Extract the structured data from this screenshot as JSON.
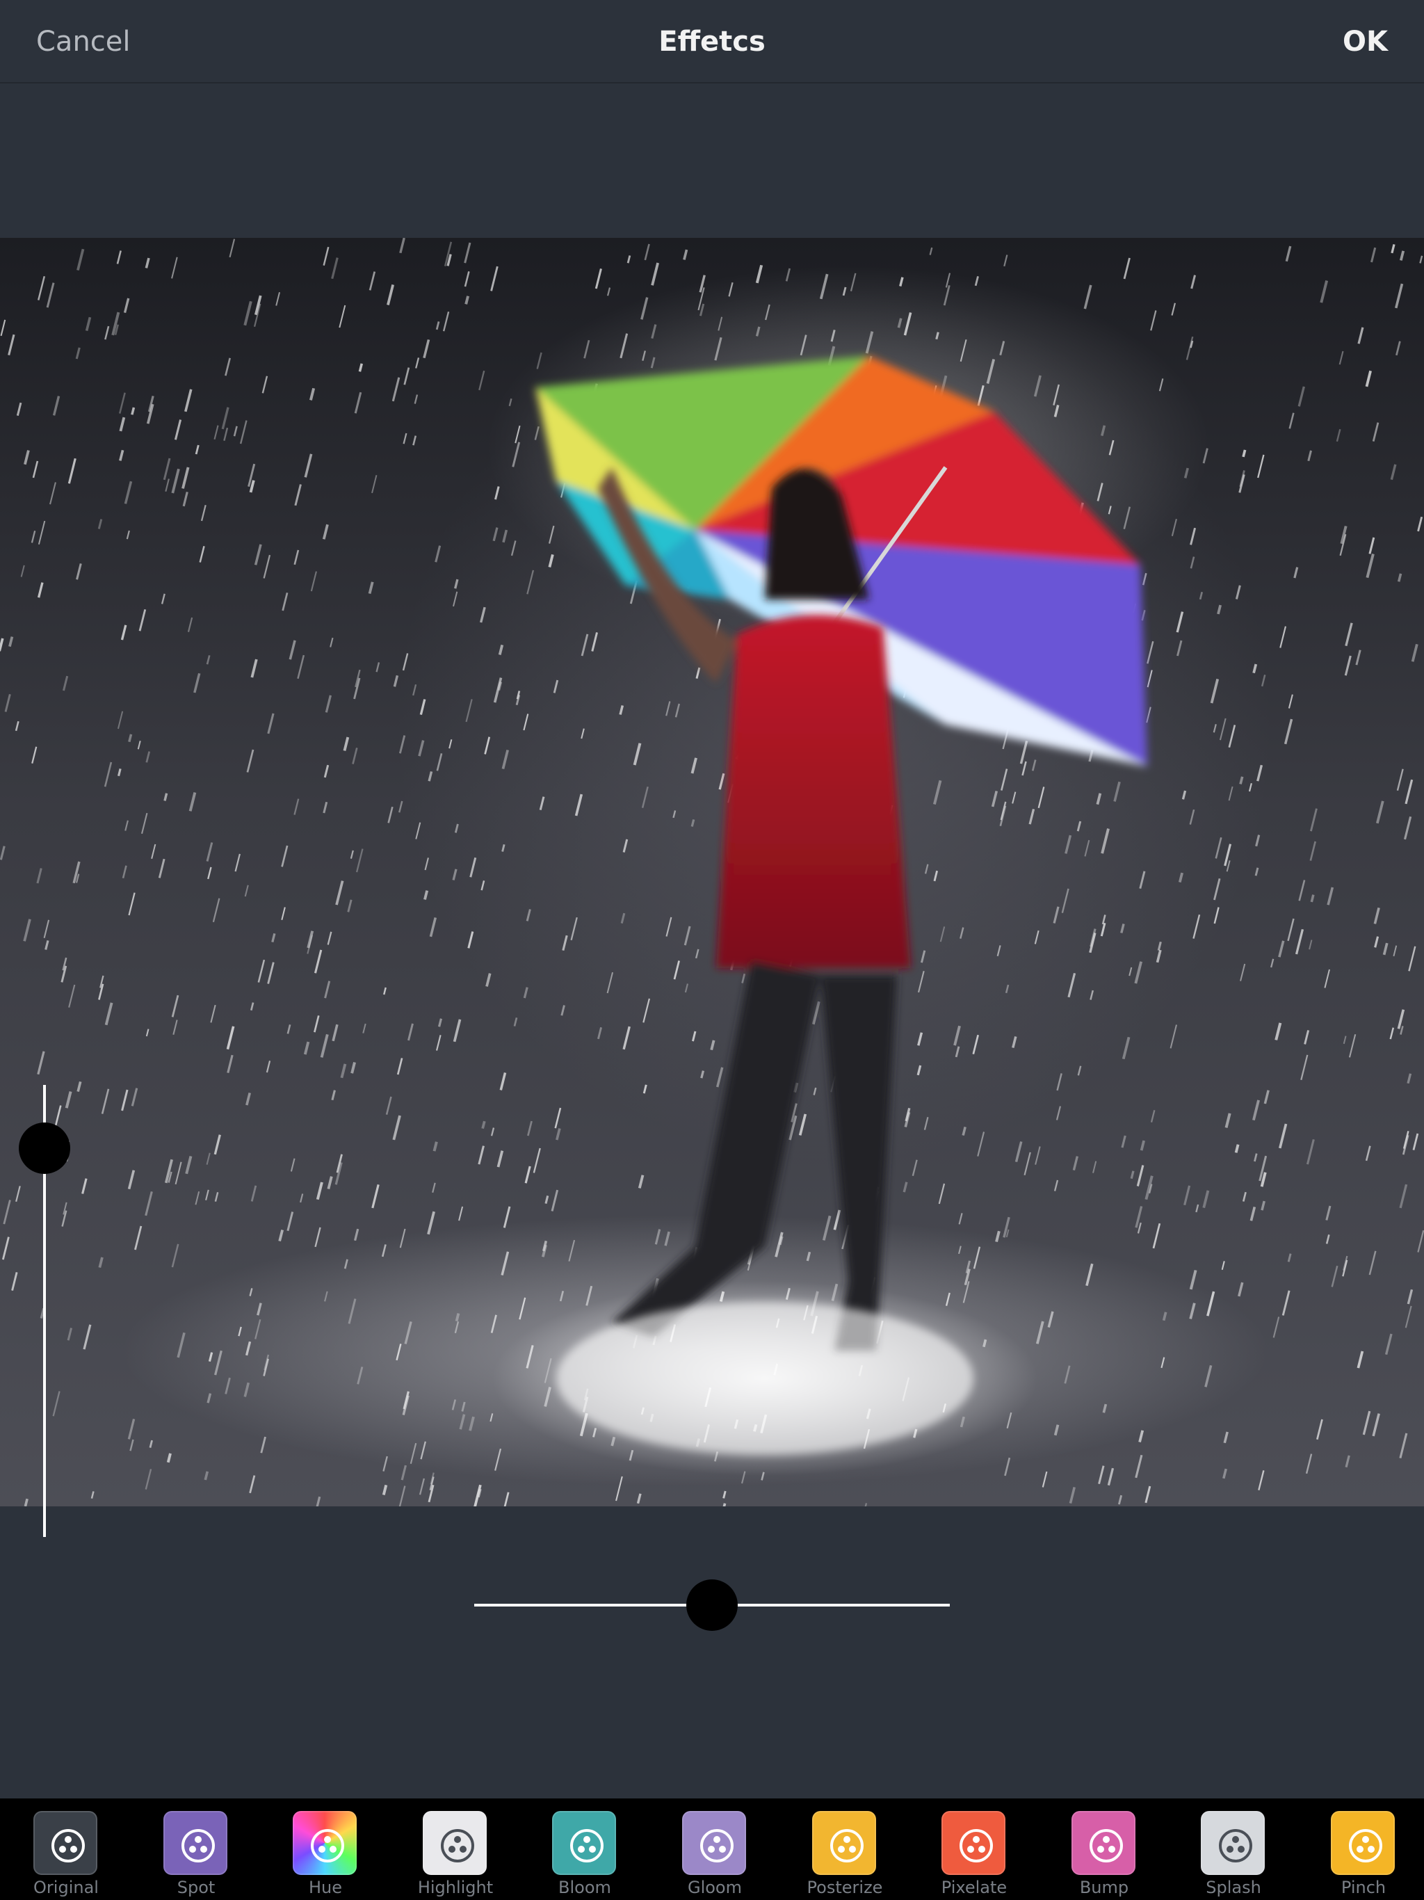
{
  "header": {
    "cancel_label": "Cancel",
    "title": "Effetcs",
    "ok_label": "OK"
  },
  "sliders": {
    "vertical_level": 0.86,
    "horizontal_level": 0.5
  },
  "effects": [
    {
      "label": "Original",
      "color": "#3a4048"
    },
    {
      "label": "Spot",
      "color": "#7a63b8"
    },
    {
      "label": "Hue",
      "color": "#4cbf7a"
    },
    {
      "label": "Highlight",
      "color": "#e9e9ec"
    },
    {
      "label": "Bloom",
      "color": "#3fa8a8"
    },
    {
      "label": "Gloom",
      "color": "#9b88c8"
    },
    {
      "label": "Posterize",
      "color": "#f2b630"
    },
    {
      "label": "Pixelate",
      "color": "#ef5b3e"
    },
    {
      "label": "Bump",
      "color": "#d75fa8"
    },
    {
      "label": "Splash",
      "color": "#d6d9dd"
    },
    {
      "label": "Pinch",
      "color": "#f4b526"
    }
  ]
}
